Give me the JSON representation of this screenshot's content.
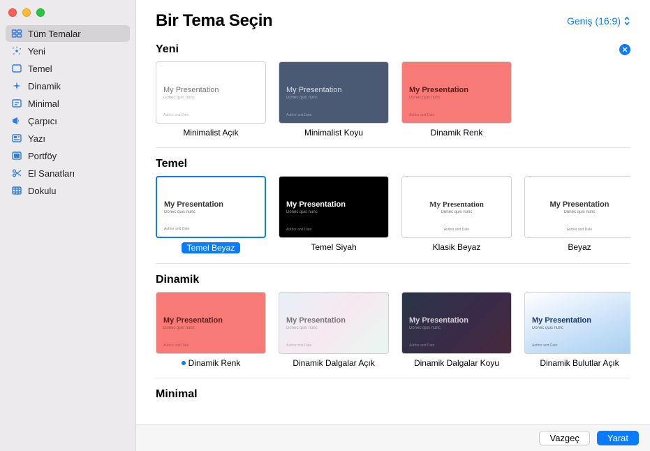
{
  "header": {
    "title": "Bir Tema Seçin"
  },
  "ratio": {
    "label": "Geniş (16:9)"
  },
  "sidebar": {
    "items": [
      {
        "label": "Tüm Temalar",
        "icon": "grid"
      },
      {
        "label": "Yeni",
        "icon": "sparkle"
      },
      {
        "label": "Temel",
        "icon": "square"
      },
      {
        "label": "Dinamik",
        "icon": "sparkle4"
      },
      {
        "label": "Minimal",
        "icon": "text"
      },
      {
        "label": "Çarpıcı",
        "icon": "megaphone"
      },
      {
        "label": "Yazı",
        "icon": "editorial"
      },
      {
        "label": "Portföy",
        "icon": "portfolio"
      },
      {
        "label": "El Sanatları",
        "icon": "scissors"
      },
      {
        "label": "Dokulu",
        "icon": "texture"
      }
    ]
  },
  "thumb": {
    "title": "My Presentation",
    "sub": "Donec quis nunc",
    "author": "Author and Date"
  },
  "sections": [
    {
      "title": "Yeni",
      "dismissible": true,
      "themes": [
        {
          "label": "Minimalist Açık",
          "variant": "t-min-light"
        },
        {
          "label": "Minimalist Koyu",
          "variant": "t-min-dark"
        },
        {
          "label": "Dinamik Renk",
          "variant": "t-dyn-red"
        }
      ]
    },
    {
      "title": "Temel",
      "themes": [
        {
          "label": "Temel Beyaz",
          "variant": "t-basic-white",
          "selected": true
        },
        {
          "label": "Temel Siyah",
          "variant": "t-basic-black"
        },
        {
          "label": "Klasik Beyaz",
          "variant": "t-classic-white"
        },
        {
          "label": "Beyaz",
          "variant": "t-white"
        }
      ],
      "peek": true
    },
    {
      "title": "Dinamik",
      "themes": [
        {
          "label": "Dinamik Renk",
          "variant": "t-dyn-red",
          "marked": true
        },
        {
          "label": "Dinamik Dalgalar Açık",
          "variant": "t-dyn-waves-light"
        },
        {
          "label": "Dinamik Dalgalar Koyu",
          "variant": "t-dyn-waves-dark"
        },
        {
          "label": "Dinamik Bulutlar Açık",
          "variant": "t-dyn-clouds"
        }
      ],
      "peek": "t-dyn-peek"
    },
    {
      "title": "Minimal",
      "themes": []
    }
  ],
  "footer": {
    "cancel": "Vazgeç",
    "create": "Yarat"
  }
}
